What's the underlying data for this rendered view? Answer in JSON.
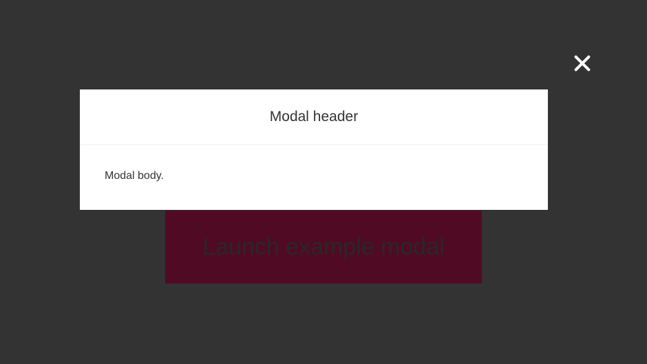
{
  "launchButton": {
    "label": "Launch example modal"
  },
  "modal": {
    "headerTitle": "Modal header",
    "bodyText": "Modal body."
  }
}
